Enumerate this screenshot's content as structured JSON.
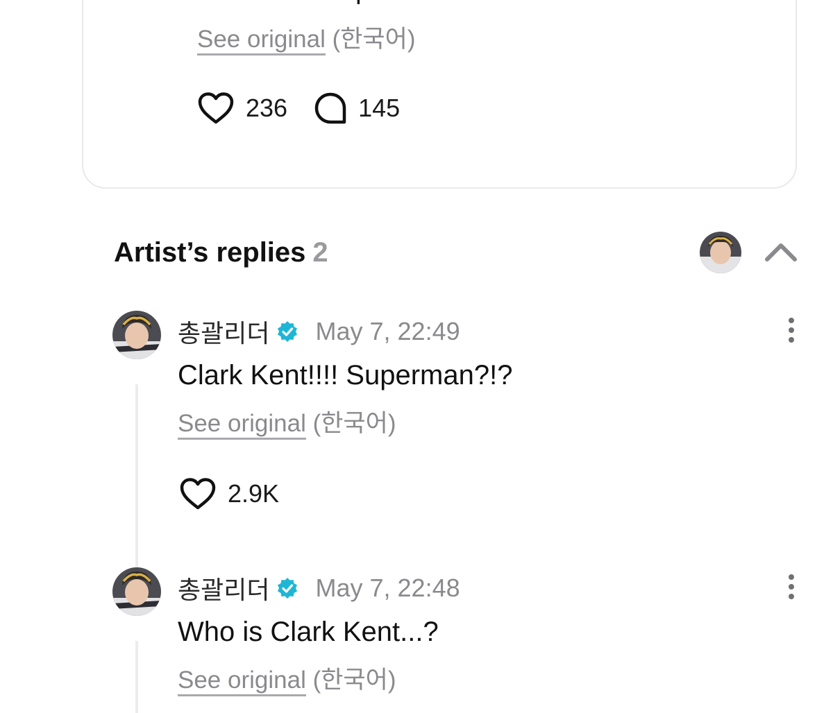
{
  "post": {
    "text": "Is Clark Kent possible?",
    "see_original_label": "See original",
    "original_language": "(한국어)",
    "like_count": "236",
    "comment_count": "145"
  },
  "artist_replies": {
    "title": "Artist’s replies",
    "count": "2",
    "replies": [
      {
        "author": "총괄리더",
        "time": "May 7, 22:49",
        "text": "Clark Kent!!!! Superman?!?",
        "see_original_label": "See original",
        "original_language": "(한국어)",
        "like_count": "2.9K"
      },
      {
        "author": "총괄리더",
        "time": "May 7, 22:48",
        "text": "Who is Clark Kent...?",
        "see_original_label": "See original",
        "original_language": "(한국어)"
      }
    ]
  },
  "icons": {
    "like": "heart-icon",
    "comment": "speech-bubble-icon",
    "verified": "verified-badge-icon",
    "more": "vertical-ellipsis-icon",
    "collapse": "chevron-up-icon"
  },
  "colors": {
    "verified": "#1fb6d6",
    "muted_text": "#8a8a8e",
    "card_border": "#e9e9ec",
    "thread_line": "#ececef"
  }
}
